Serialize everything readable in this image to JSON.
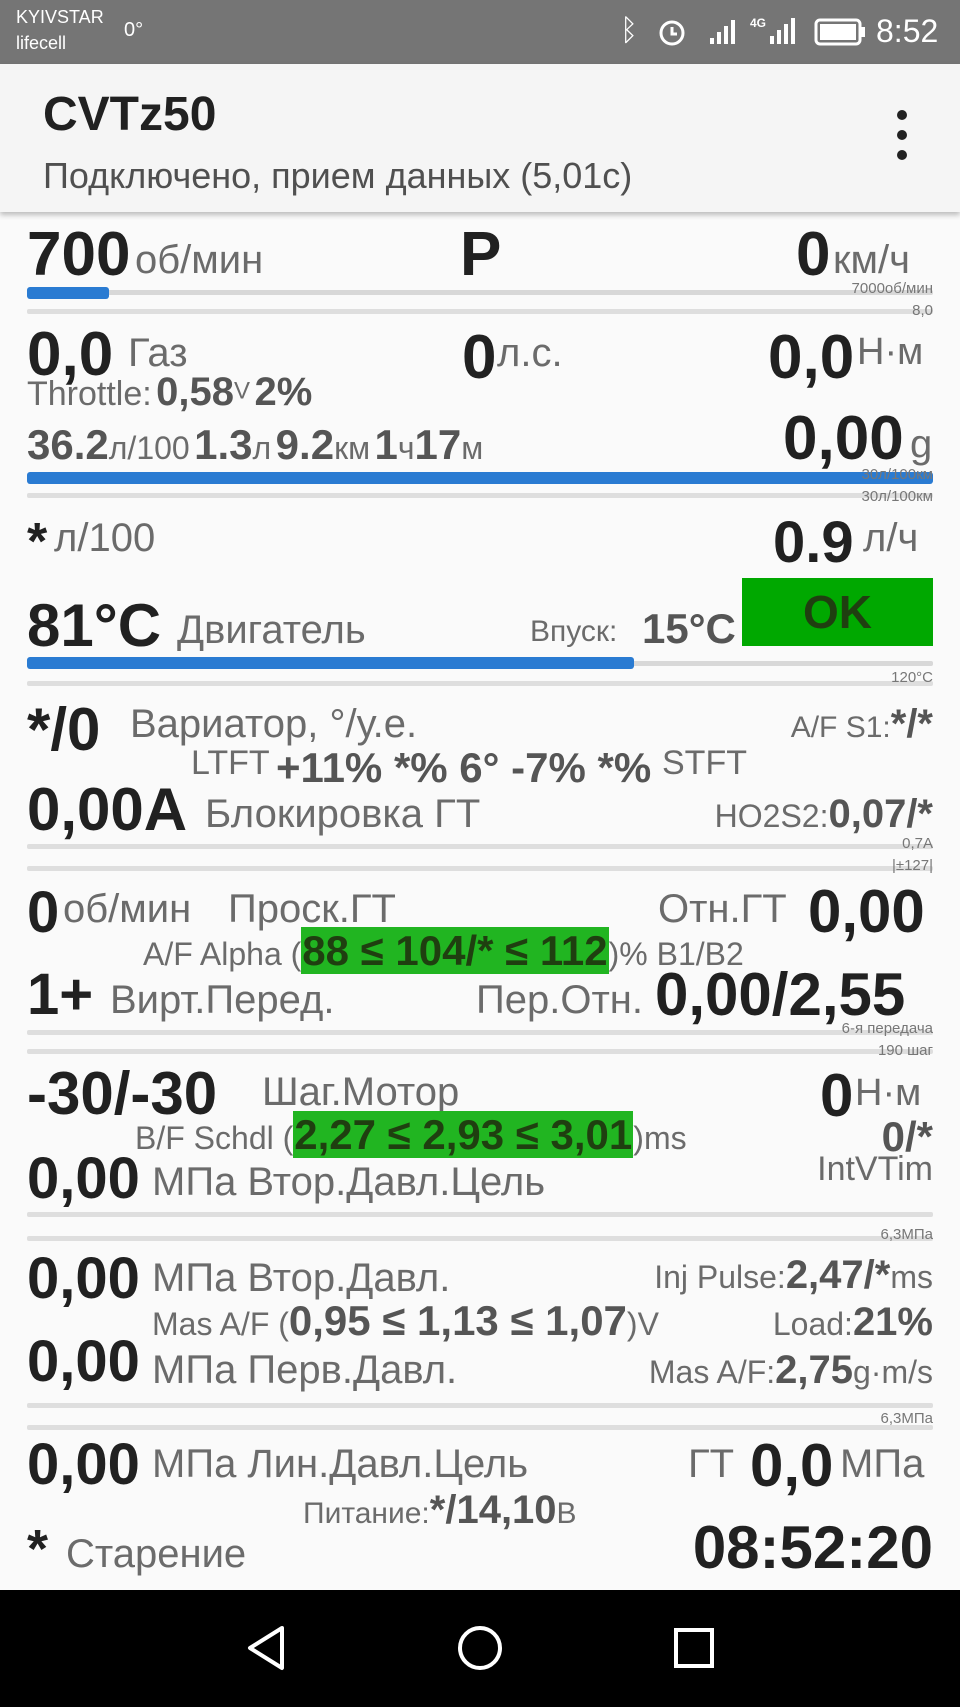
{
  "status_bar": {
    "carrier1": "KYIVSTAR",
    "carrier2": "lifecell",
    "temp": "0°",
    "time": "8:52"
  },
  "app_bar": {
    "title": "CVTz50",
    "subtitle": "Подключено, прием данных (5,01с)"
  },
  "row1": {
    "rpm": "700",
    "rpm_unit": "об/мин",
    "gear": "P",
    "speed": "0",
    "speed_unit": "км/ч",
    "max_rpm": "7000об/мин",
    "scale_val": "8,0",
    "rpm_fraction": 0.09
  },
  "row2": {
    "throttle_val": "0,0",
    "throttle_label": "Газ",
    "hp": "0",
    "hp_unit": "л.с.",
    "torque": "0,0",
    "torque_unit": "Н·м",
    "throttle_sensor_label": "Throttle:",
    "throttle_v": "0,58",
    "throttle_v_unit": "V",
    "throttle_pct": "2%"
  },
  "row3": {
    "cons": "36.2",
    "cons_unit": "л/100",
    "fuel": "1.3",
    "fuel_unit": "л",
    "dist": "9.2",
    "dist_unit": "км",
    "hours": "1",
    "hours_unit": "ч",
    "mins": "17",
    "mins_unit": "м",
    "g_val": "0,00",
    "g_unit": "g",
    "scale1": "30л/100км",
    "scale2": "30л/100км"
  },
  "row4": {
    "inst_cons": "*",
    "inst_cons_unit": "л/100",
    "flow": "0.9",
    "flow_unit": "л/ч"
  },
  "row5": {
    "engine_temp": "81°C",
    "engine_label": "Двигатель",
    "intake_label": "Впуск:",
    "intake_temp": "15°C",
    "status": "OK",
    "scale": "120°C",
    "colors": {
      "ok_bg": "#00a800",
      "ok_text": "#1f3f10"
    },
    "temp_fraction": 0.67
  },
  "row6": {
    "cvt_val": "*/0",
    "cvt_label": "Вариатор, °/у.е.",
    "af_s1_label": "A/F S1:",
    "af_s1_val": "*/*",
    "ltft_label": "LTFT",
    "trims": "+11% *% 6° -7% *%",
    "stft_label": "STFT",
    "lockup_val": "0,00A",
    "lockup_label": "Блокировка ГТ",
    "ho2s2_label": "HO2S2:",
    "ho2s2_val": "0,07/*",
    "scale1": "0,7A",
    "scale2": "|±127|"
  },
  "row7": {
    "slip_val": "0",
    "slip_unit": "об/мин",
    "slip_label": "Проск.ГТ",
    "tc_ratio_label": "Отн.ГТ",
    "tc_ratio_val": "0,00",
    "af_alpha_label": "A/F Alpha (",
    "af_alpha_range": "88 ≤ 104/* ≤ 112",
    "af_alpha_suffix": ")% B1/B2",
    "virt_gear_val": "1+",
    "virt_gear_label": "Вирт.Перед.",
    "gear_ratio_label": "Пер.Отн.",
    "gear_ratio_val": "0,00/2,55",
    "scale1": "6-я передача",
    "scale2": "190 шаг"
  },
  "row8": {
    "step_val": "-30/-30",
    "step_label": "Шаг.Мотор",
    "torque_val": "0",
    "torque_unit": "Н·м",
    "bf_label": "B/F Schdl (",
    "bf_range": "2,27 ≤ 2,93 ≤ 3,01",
    "bf_suffix": ")ms",
    "intv_val": "0/*",
    "sec_target_val": "0,00",
    "sec_target_label": "МПа Втор.Давл.Цель",
    "intv_label": "IntVTim",
    "scale": "6,3МПа"
  },
  "row9": {
    "sec_val": "0,00",
    "sec_label": "МПа Втор.Давл.",
    "inj_label": "Inj Pulse:",
    "inj_val": "2,47/*",
    "inj_unit": "ms",
    "maf_label": "Mas A/F (",
    "maf_range": "0,95 ≤ 1,13 ≤ 1,07",
    "maf_suffix": ")V",
    "load_label": "Load:",
    "load_val": "21%",
    "pri_val": "0,00",
    "pri_label": "МПа Перв.Давл.",
    "maf2_label": "Mas A/F:",
    "maf2_val": "2,75",
    "maf2_unit": "g·m/s",
    "scale": "6,3МПа"
  },
  "row10": {
    "line_val": "0,00",
    "line_label": "МПа Лин.Давл.Цель",
    "gt_label": "ГТ",
    "gt_val": "0,0",
    "gt_unit": "МПа",
    "power_label": "Питание:",
    "power_val": "*/14,10",
    "power_unit": "В",
    "aging_val": "*",
    "aging_label": "Старение",
    "clock": "08:52:20"
  }
}
